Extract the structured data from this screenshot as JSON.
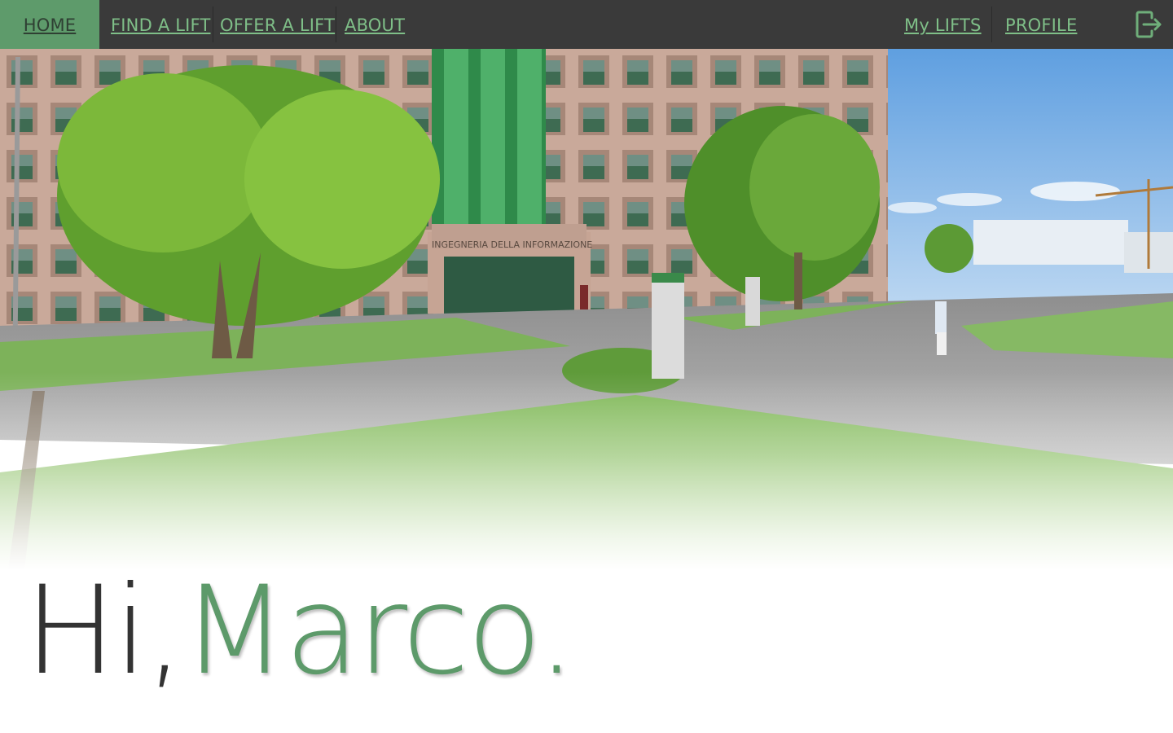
{
  "nav": {
    "home": "HOME",
    "find": "FIND A LIFT",
    "offer": "OFFER A LIFT",
    "about": "ABOUT",
    "my_lifts": "My LIFTS",
    "profile": "PROFILE",
    "logout_icon": "logout-icon"
  },
  "hero": {
    "sign_text": "INGEGNERIA DELLA INFORMAZIONE"
  },
  "greeting": {
    "hi": "Hi,",
    "name": "Marco."
  },
  "colors": {
    "navbar": "#3a3a3a",
    "active_tab": "#5e9b6b",
    "link": "#7fbf88",
    "accent": "#5d9a6a",
    "text": "#333333"
  }
}
